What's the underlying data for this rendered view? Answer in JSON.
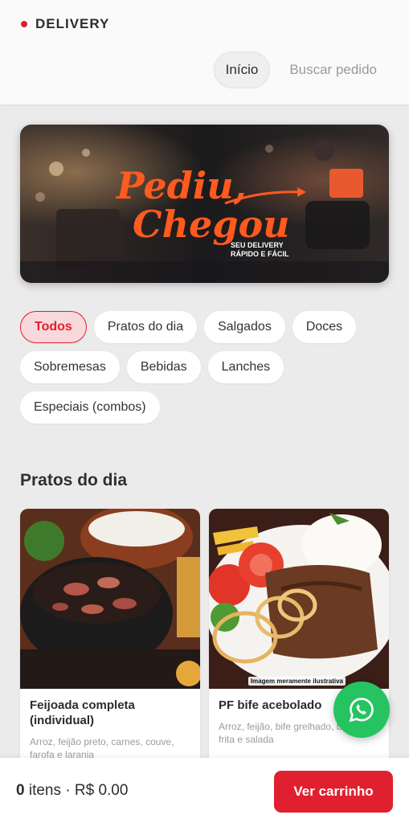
{
  "header": {
    "brand": "DELIVERY",
    "nav": [
      {
        "label": "Início",
        "active": true
      },
      {
        "label": "Buscar pedido",
        "active": false
      }
    ]
  },
  "banner": {
    "headline_line1": "Pediu,",
    "headline_line2": "Chegou",
    "tagline_line1": "SEU DELIVERY",
    "tagline_line2": "RÁPIDO E FÁCIL"
  },
  "categories": [
    {
      "label": "Todos",
      "active": true
    },
    {
      "label": "Pratos do dia",
      "active": false
    },
    {
      "label": "Salgados",
      "active": false
    },
    {
      "label": "Doces",
      "active": false
    },
    {
      "label": "Sobremesas",
      "active": false
    },
    {
      "label": "Bebidas",
      "active": false
    },
    {
      "label": "Lanches",
      "active": false
    },
    {
      "label": "Especiais (combos)",
      "active": false
    }
  ],
  "section": {
    "title": "Pratos do dia"
  },
  "products": [
    {
      "name": "Feijoada completa (individual)",
      "description": "Arroz, feijão preto, carnes, couve, farofa e laranja"
    },
    {
      "name": "PF bife acebolado",
      "description": "Arroz, feijão, bife grelhado, batata frita e salada",
      "image_note": "Imagem meramente ilustrativa"
    }
  ],
  "cart": {
    "count": "0",
    "summary": "itens · R$ 0.00",
    "button_label": "Ver carrinho"
  },
  "colors": {
    "accent": "#e0202e",
    "whatsapp": "#25c461"
  },
  "icons": [
    "whatsapp-icon"
  ]
}
